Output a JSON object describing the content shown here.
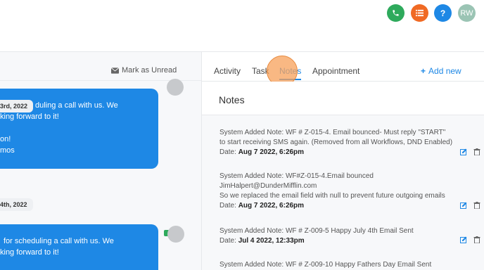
{
  "topbar": {
    "avatar_initials": "RW",
    "buttons": [
      {
        "name": "phone-icon",
        "color": "#2eaa5c"
      },
      {
        "name": "list-icon",
        "color": "#f06a24"
      },
      {
        "name": "help-icon",
        "label": "?",
        "color": "#1e88e5"
      }
    ]
  },
  "conversation": {
    "mark_unread_label": "Mark as Unread",
    "messages": [
      {
        "date_chip": "3rd, 2022",
        "lines": [
          "duling a call with us. We",
          "king forward to it!",
          "",
          "on!",
          "mos"
        ]
      },
      {
        "date_chip": "4th, 2022",
        "lines": [
          "for scheduling a call with us. We",
          "king forward to it!"
        ]
      }
    ]
  },
  "tabs": {
    "items": [
      "Activity",
      "Task",
      "Notes",
      "Appointment"
    ],
    "active": "Notes",
    "add_new_label": "Add new"
  },
  "notes_panel": {
    "title": "Notes",
    "date_label": "Date:",
    "notes": [
      {
        "lines": [
          "System Added Note: WF # Z-015-4. Email bounced- Must reply \"START\"",
          "to start receiving SMS again. (Removed from all Workflows, DND Enabled)"
        ],
        "date": "Aug 7 2022, 6:26pm"
      },
      {
        "lines": [
          "System Added Note: WF#Z-015-4.Email bounced",
          "JimHalpert@DunderMifflin.com",
          "So we replaced the email field with null to prevent future outgoing emails"
        ],
        "date": "Aug 7 2022, 6:26pm"
      },
      {
        "lines": [
          "System Added Note: WF # Z-009-5 Happy July 4th Email Sent"
        ],
        "date": "Jul 4 2022, 12:33pm"
      },
      {
        "lines": [
          "System Added Note: WF # Z-009-10 Happy Fathers Day Email Sent"
        ],
        "date": ""
      }
    ]
  },
  "colors": {
    "accent": "#1e88e5",
    "bubble": "#1e88e5"
  }
}
